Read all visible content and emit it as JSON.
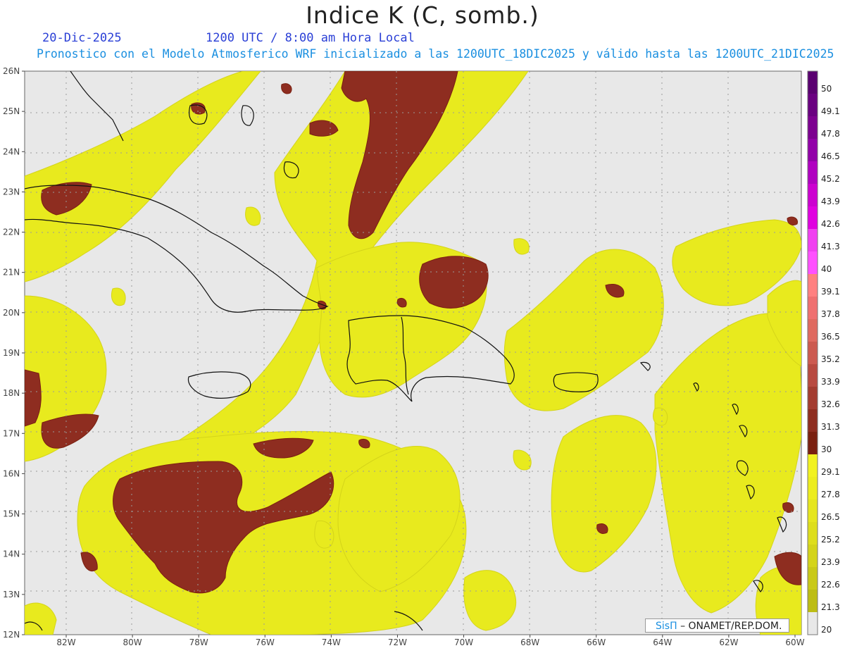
{
  "header": {
    "title": "Indice K (C, somb.)",
    "date": "20-Dic-2025",
    "time": "1200 UTC / 8:00 am Hora Local",
    "subtitle": "Pronostico con el Modelo Atmosferico WRF inicializado a las 1200UTC_18DIC2025 y válido hasta las  1200UTC_21DIC2025"
  },
  "map": {
    "lat_labels": [
      "26N",
      "25N",
      "24N",
      "23N",
      "22N",
      "21N",
      "20N",
      "19N",
      "18N",
      "17N",
      "16N",
      "15N",
      "14N",
      "13N",
      "12N"
    ],
    "lon_labels": [
      "82W",
      "80W",
      "78W",
      "76W",
      "74W",
      "72W",
      "70W",
      "68W",
      "66W",
      "64W",
      "62W",
      "60W"
    ],
    "lat_range": [
      12,
      26
    ],
    "lon_range": [
      -83.3,
      -60
    ],
    "background": "#e8e8e8"
  },
  "colorbar": {
    "labels": [
      "50",
      "49.1",
      "47.8",
      "46.5",
      "45.2",
      "43.9",
      "42.6",
      "41.3",
      "40",
      "39.1",
      "37.8",
      "36.5",
      "35.2",
      "33.9",
      "32.6",
      "31.3",
      "30",
      "29.1",
      "27.8",
      "26.5",
      "25.2",
      "23.9",
      "22.6",
      "21.3",
      "20"
    ],
    "colors": [
      "#5a0070",
      "#6a0080",
      "#7d0090",
      "#9200a8",
      "#b000c0",
      "#cc00d0",
      "#e000e0",
      "#f040f0",
      "#ff50ff",
      "#ff8080",
      "#ef7070",
      "#df6a60",
      "#cc5a50",
      "#b84a40",
      "#a33c30",
      "#8e2d20",
      "#7a2010",
      "#f2f220",
      "#eded1e",
      "#e6e61e",
      "#dede1c",
      "#d4d41a",
      "#c9c918",
      "#bdbd14",
      "#e8e8e8"
    ]
  },
  "credit": {
    "brand": "SisΠ",
    "text": "– ONAMET/REP.DOM."
  }
}
